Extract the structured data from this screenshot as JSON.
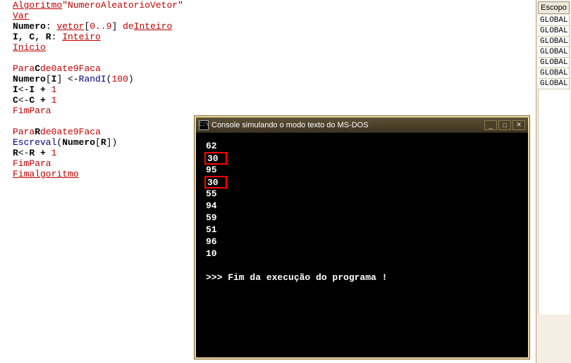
{
  "code": {
    "algname": "\"NumeroAleatorioVetor\"",
    "decl1_id": "Numero",
    "decl1_vetor": "vetor",
    "decl1_range": "0..9",
    "decl1_de": "de",
    "decl1_type": "Inteiro",
    "decl2_ids": "I, C, R",
    "decl2_type": "Inteiro",
    "kw_algoritmo": "Algoritmo",
    "kw_var": "Var",
    "kw_inicio": "Inicio",
    "kw_para": "Para",
    "kw_de": "de",
    "kw_ate": "ate",
    "kw_faca": "Faca",
    "kw_fimpara": "FimPara",
    "kw_fimalg": "Fimalgoritmo",
    "loop1_var": "C",
    "loop1_from": "0",
    "loop1_to": "9",
    "body_numero": "Numero",
    "body_idx": "I",
    "body_arrow": "<-",
    "body_fn": "RandI",
    "body_arg": "100",
    "inc_i_l": "I",
    "inc_i_r": "I + ",
    "inc_i_n": "1",
    "inc_c_l": "C",
    "inc_c_r": "C + ",
    "inc_c_n": "1",
    "loop2_var": "R",
    "loop2_from": "0",
    "loop2_to": "9",
    "escreval_fn": "Escreval",
    "escreval_arg_id": "Numero",
    "escreval_arg_idx": "R",
    "inc_r_l": "R",
    "inc_r_r": "R + ",
    "inc_r_n": "1"
  },
  "scope": {
    "header": "Escopo",
    "cells": [
      "GLOBAL",
      "GLOBAL",
      "GLOBAL",
      "GLOBAL",
      "GLOBAL",
      "GLOBAL",
      "GLOBAL"
    ]
  },
  "console": {
    "title": "Console simulando o modo texto do MS-DOS",
    "icon_text": "C:\\",
    "output": [
      "62",
      "30",
      "95",
      "30",
      "55",
      "94",
      "59",
      "51",
      "96",
      "10"
    ],
    "highlighted_indices": [
      1,
      3
    ],
    "end_msg": ">>> Fim da execução do programa !"
  }
}
